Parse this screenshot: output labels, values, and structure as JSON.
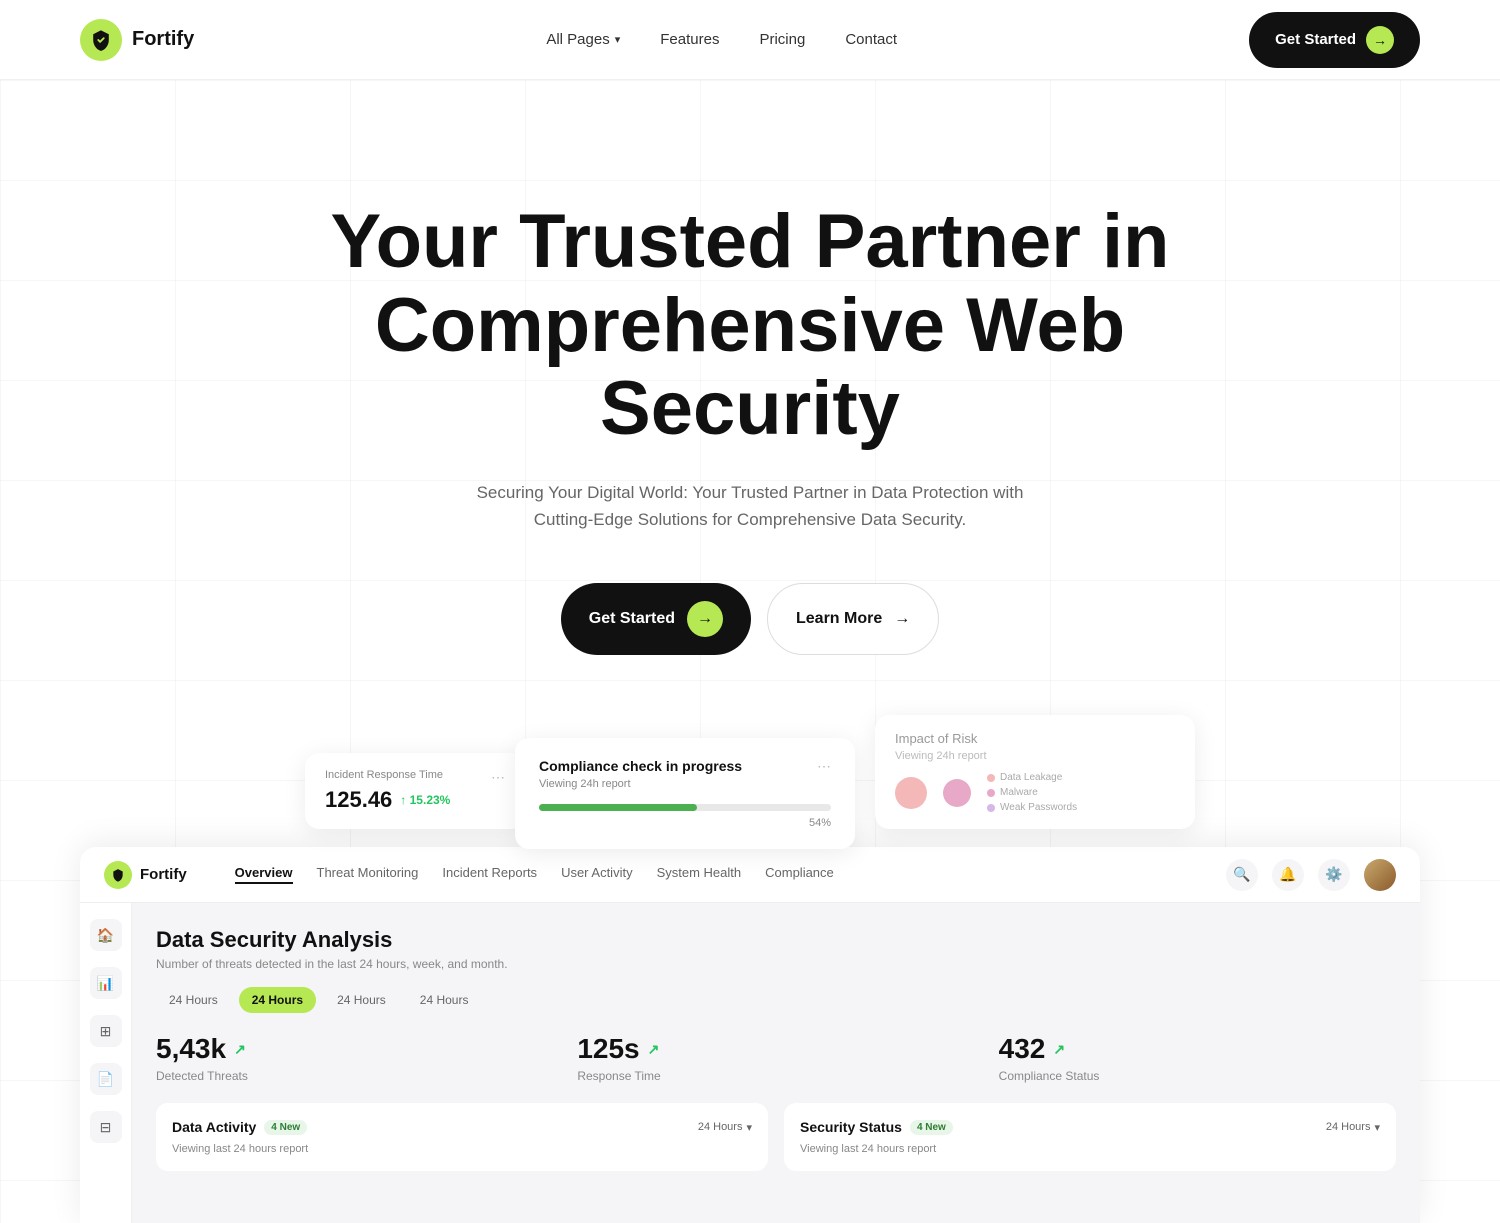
{
  "nav": {
    "logo_text": "Fortify",
    "links": [
      {
        "label": "All Pages",
        "dropdown": true
      },
      {
        "label": "Features",
        "dropdown": false
      },
      {
        "label": "Pricing",
        "dropdown": false
      },
      {
        "label": "Contact",
        "dropdown": false
      }
    ],
    "cta_label": "Get Started",
    "cta_arrow": "→"
  },
  "hero": {
    "title_line1": "Your Trusted Partner in",
    "title_line2": "Comprehensive Web Security",
    "subtitle": "Securing Your Digital World: Your Trusted Partner in Data Protection with Cutting-Edge Solutions for Comprehensive Data Security.",
    "btn_primary": "Get Started",
    "btn_primary_arrow": "→",
    "btn_secondary": "Learn More",
    "btn_secondary_arrow": "→"
  },
  "floating_cards": {
    "left": {
      "label": "Incident Response Time",
      "value": "125.46",
      "trend": "↑ 15.23%"
    },
    "center": {
      "title": "Compliance check in progress",
      "subtitle": "Viewing 24h report",
      "progress_pct": "54%"
    },
    "right": {
      "title": "Impact of Risk",
      "subtitle": "Viewing 24h report",
      "legend": [
        {
          "label": "Data Leakage",
          "color": "#f4b8b8"
        },
        {
          "label": "Malware",
          "color": "#e8a8c8"
        },
        {
          "label": "Weak Passwords",
          "color": "#d4b8e8"
        }
      ]
    }
  },
  "dashboard": {
    "logo": "Fortify",
    "nav_links": [
      {
        "label": "Overview",
        "active": true
      },
      {
        "label": "Threat Monitoring",
        "active": false
      },
      {
        "label": "Incident Reports",
        "active": false
      },
      {
        "label": "User Activity",
        "active": false
      },
      {
        "label": "System Health",
        "active": false
      },
      {
        "label": "Compliance",
        "active": false
      }
    ],
    "main": {
      "title": "Data Security Analysis",
      "subtitle": "Number of threats detected in the last 24 hours, week, and month.",
      "tabs": [
        "24 Hours",
        "24 Hours",
        "24 Hours",
        "24 Hours"
      ],
      "active_tab_index": 1,
      "stats": [
        {
          "value": "5,43k",
          "arrow": "↗",
          "label": "Detected Threats"
        },
        {
          "value": "125s",
          "arrow": "↗",
          "label": "Response Time"
        },
        {
          "value": "432",
          "arrow": "↗",
          "label": "Compliance Status"
        }
      ]
    },
    "cards": [
      {
        "title": "Data Activity",
        "badge": "4 New",
        "subtitle": "Viewing last 24 hours report",
        "hours_label": "24 Hours",
        "hours_arrow": "▾"
      },
      {
        "title": "Security Status",
        "badge": "4 New",
        "subtitle": "Viewing last 24 hours report",
        "hours_label": "24 Hours",
        "hours_arrow": "▾"
      }
    ]
  },
  "colors": {
    "accent": "#b5e853",
    "dark": "#111111",
    "text_muted": "#888888",
    "green_trend": "#22c55e"
  }
}
